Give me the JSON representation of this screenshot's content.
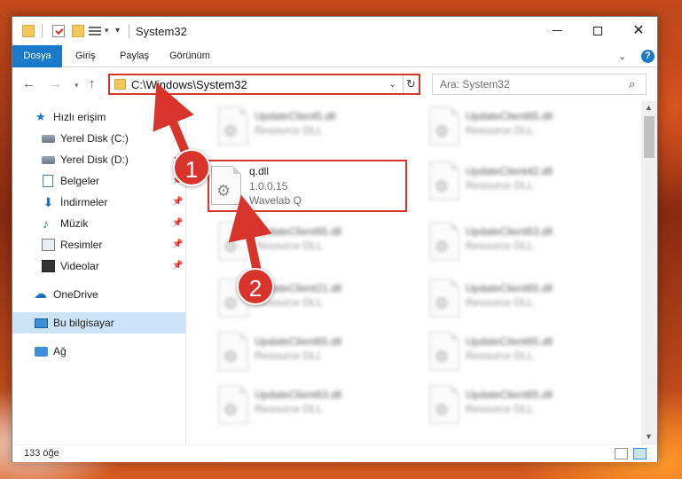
{
  "window": {
    "title": "System32"
  },
  "ribbon": {
    "file": "Dosya",
    "tabs": [
      "Giriş",
      "Paylaş",
      "Görünüm"
    ]
  },
  "nav": {
    "address": "C:\\Windows\\System32",
    "search_placeholder": "Ara: System32"
  },
  "sidebar": {
    "items": [
      {
        "label": "Hızlı erişim",
        "icon": "star-icon"
      },
      {
        "label": "Yerel Disk (C:)",
        "icon": "drive-icon"
      },
      {
        "label": "Yerel Disk (D:)",
        "icon": "drive-icon"
      },
      {
        "label": "Belgeler",
        "icon": "documents-icon"
      },
      {
        "label": "İndirmeler",
        "icon": "downloads-icon"
      },
      {
        "label": "Müzik",
        "icon": "music-icon"
      },
      {
        "label": "Resimler",
        "icon": "pictures-icon"
      },
      {
        "label": "Videolar",
        "icon": "videos-icon"
      },
      {
        "label": "OneDrive",
        "icon": "cloud-icon"
      },
      {
        "label": "Bu bilgisayar",
        "icon": "computer-icon"
      },
      {
        "label": "Ağ",
        "icon": "network-icon"
      }
    ]
  },
  "files": {
    "highlighted": {
      "name": "q.dll",
      "version": "1.0.0.15",
      "product": "Wavelab Q"
    },
    "left_column": [
      {
        "name": "UpdateClient5.dll",
        "desc": "Resource DLL"
      },
      {
        "name": "UpdateClient65.dll",
        "desc": "Resource DLL"
      },
      {
        "name": "UpdateClient21.dll",
        "desc": "Resource DLL"
      },
      {
        "name": "UpdateClient65.dll",
        "desc": "Resource DLL"
      },
      {
        "name": "UpdateClient63.dll",
        "desc": "Resource DLL"
      }
    ],
    "right_column": [
      {
        "name": "UpdateClient65.dll",
        "desc": "Resource DLL"
      },
      {
        "name": "UpdateClient42.dll",
        "desc": "Resource DLL"
      },
      {
        "name": "UpdateClient63.dll",
        "desc": "Resource DLL"
      },
      {
        "name": "UpdateClient65.dll",
        "desc": "Resource DLL"
      },
      {
        "name": "UpdateClient65.dll",
        "desc": "Resource DLL"
      },
      {
        "name": "UpdateClient65.dll",
        "desc": "Resource DLL"
      }
    ]
  },
  "status": {
    "count": "133 öğe"
  },
  "annotations": {
    "step1": "1",
    "step2": "2"
  },
  "colors": {
    "accent": "#1979ca",
    "annotation": "#d9342b"
  }
}
